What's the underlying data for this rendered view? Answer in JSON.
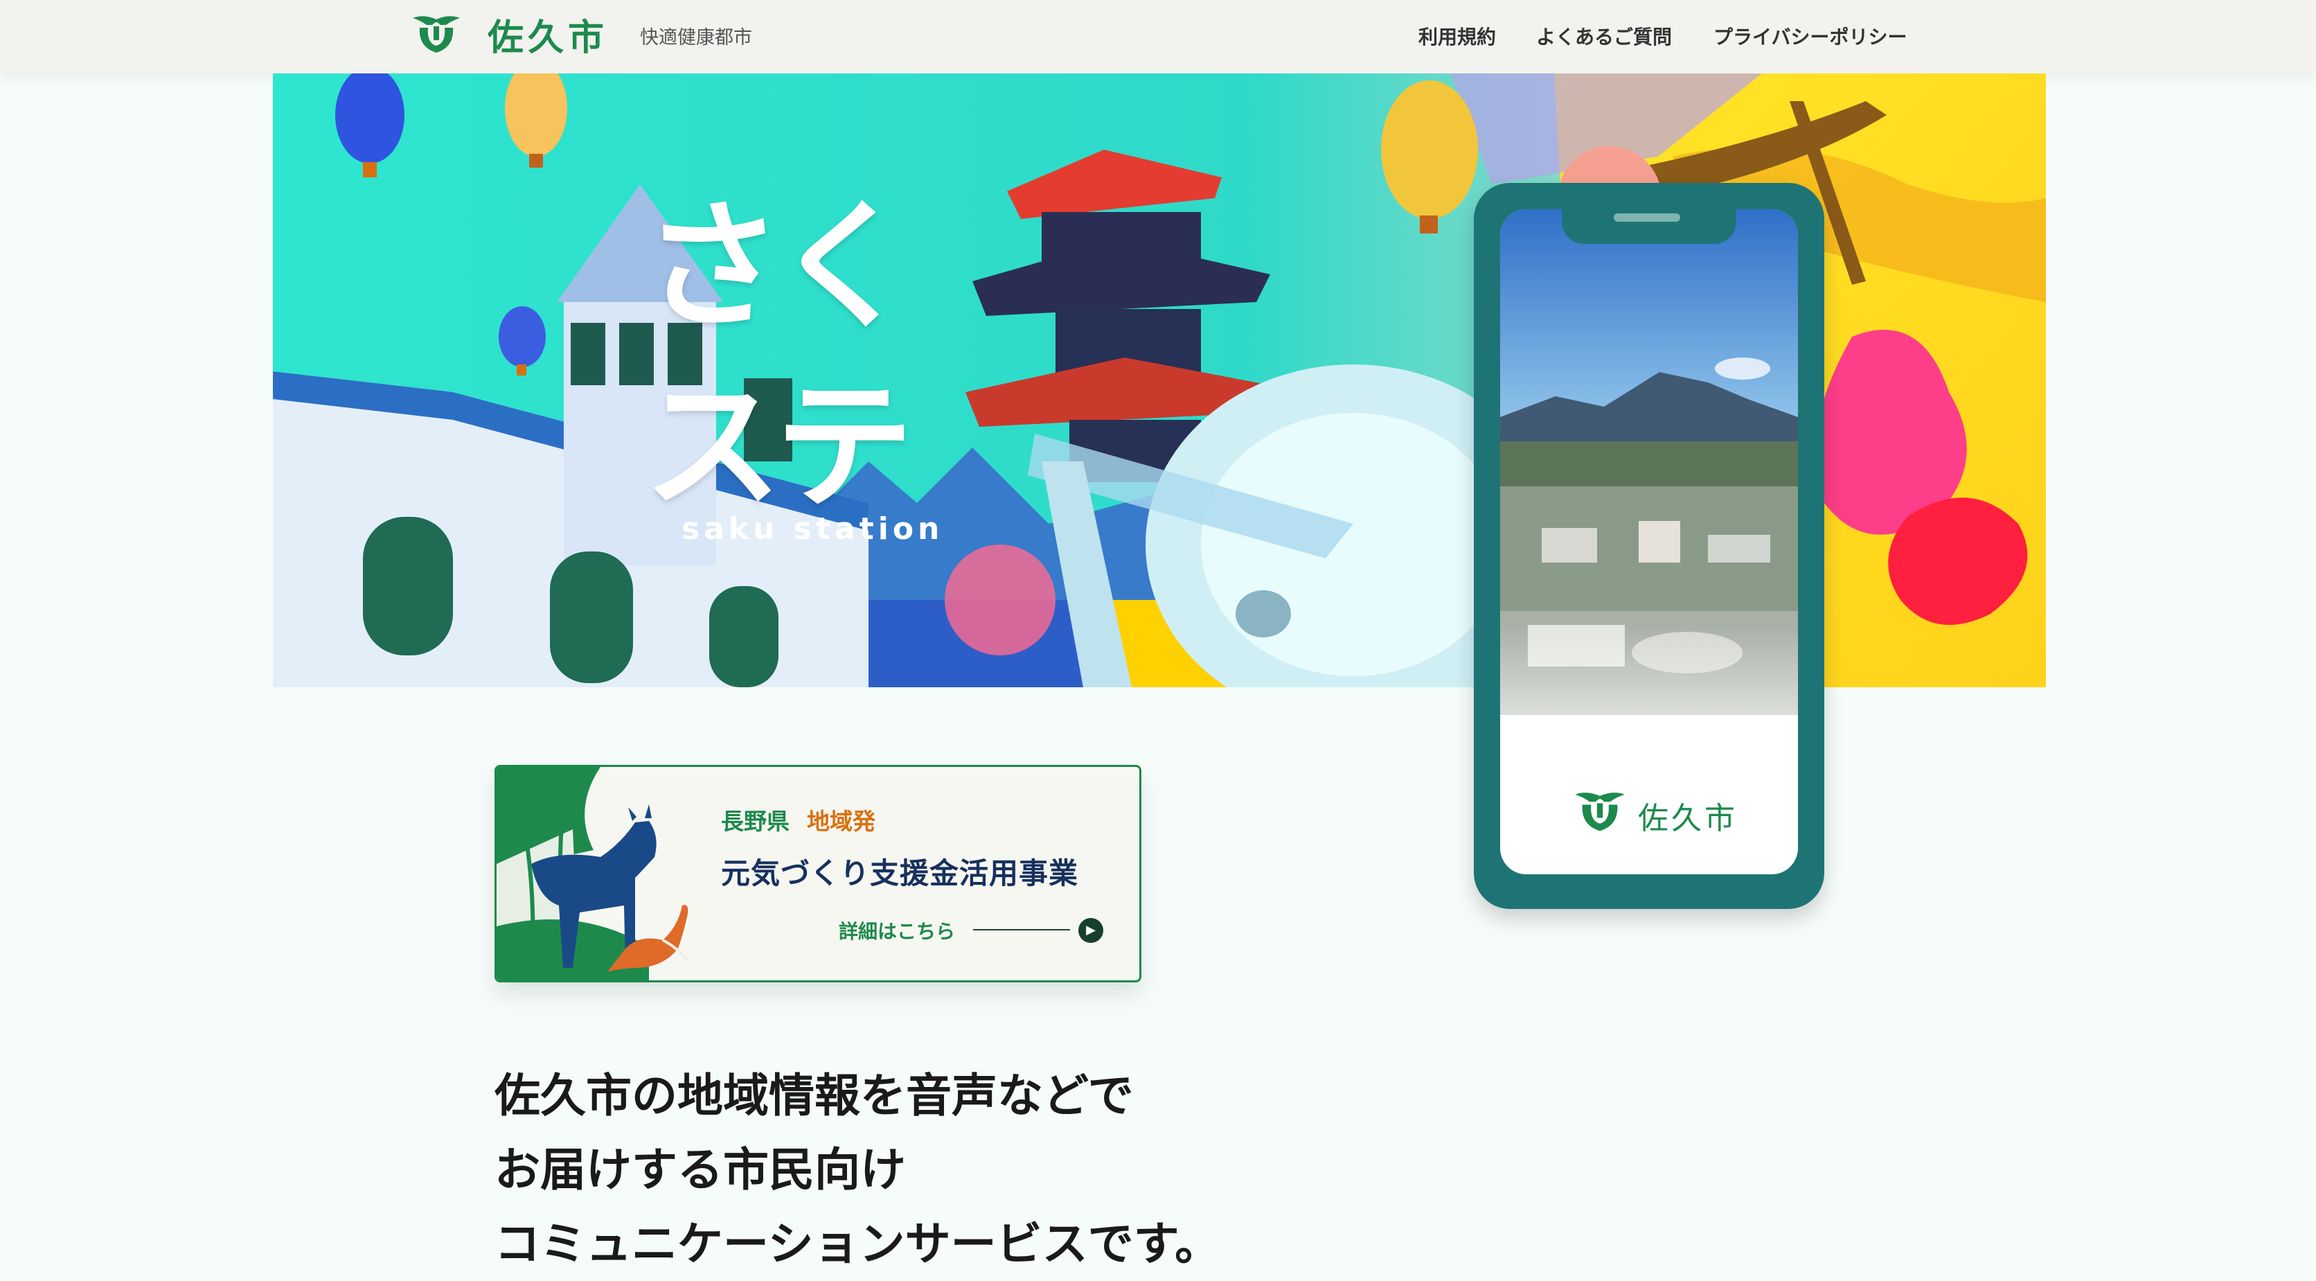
{
  "header": {
    "logo_text": "佐久市",
    "tagline": "快適健康都市",
    "nav": [
      {
        "label": "利用規約"
      },
      {
        "label": "よくあるご質問"
      },
      {
        "label": "プライバシーポリシー"
      }
    ]
  },
  "hero": {
    "title_line1": "さく",
    "title_line2": "ステ",
    "subtitle": "saku station"
  },
  "phone": {
    "brand": "佐久市"
  },
  "banner": {
    "prefecture": "長野県",
    "region": "地域発",
    "title": "元気づくり支援金活用事業",
    "link": "詳細はこちら",
    "arrow": "▶"
  },
  "lead": {
    "line1": "佐久市の地域情報を音声などで",
    "line2": "お届けする市民向け",
    "line3": "コミュニケーションサービスです。"
  },
  "colors": {
    "brand_green": "#1d8a4c",
    "phone_teal": "#1e7475",
    "hero_aqua": "#2ee6cf",
    "hero_yellow": "#ffe628",
    "accent_orange": "#d9700f",
    "navy_text": "#17305e"
  }
}
